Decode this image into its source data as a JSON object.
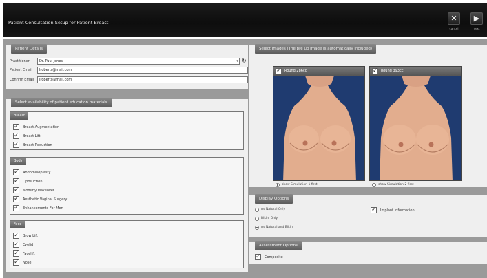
{
  "window": {
    "title": "Patient Consultation Setup for Patient Breast",
    "cancel_label": "cancel",
    "next_label": "next"
  },
  "patient_details": {
    "header": "Patient Details",
    "practitioner_label": "Practitioner",
    "practitioner_value": "Dr. Paul Jones",
    "email_label": "Patient Email",
    "email_value": "lroberts@mail.com",
    "confirm_label": "Confirm Email",
    "confirm_value": "lroberts@mail.com"
  },
  "education": {
    "header": "Select availability of patient education materials",
    "groups": [
      {
        "title": "Breast",
        "items": [
          "Breast Augmentation",
          "Breast Lift",
          "Breast Reduction"
        ]
      },
      {
        "title": "Body",
        "items": [
          "Abdominoplasty",
          "Liposuction",
          "Mommy Makeover",
          "Aesthetic Vaginal Surgery",
          "Enhancements For Men"
        ]
      },
      {
        "title": "Face",
        "items": [
          "Brow Lift",
          "Eyelid",
          "Facelift",
          "Nose"
        ]
      }
    ]
  },
  "images": {
    "header": "Select Images  (The pre up image is automatically included)",
    "cards": [
      {
        "caption": "Round 286cc",
        "radio_label": "show Simulation 1 first",
        "selected": true
      },
      {
        "caption": "Round 393cc",
        "radio_label": "show Simulation 2 first",
        "selected": false
      }
    ]
  },
  "display_options": {
    "header": "Display Options",
    "radios": [
      {
        "label": "As Natural Only",
        "selected": false
      },
      {
        "label": "Bikini Only",
        "selected": false
      },
      {
        "label": "As Natural and Bikini",
        "selected": true
      }
    ],
    "implant_info_label": "Implant Information"
  },
  "assessment": {
    "header": "Assessment Options",
    "composite_label": "Composite"
  },
  "icons": {
    "cancel": "cancel-x-icon",
    "next": "next-arrow-icon",
    "dropdown": "dropdown-arrow-icon",
    "refresh": "refresh-icon",
    "checkbox": "checkmark-icon"
  },
  "colors": {
    "top_bar": "#111111",
    "panel_header": "#6e6e6e",
    "photo_background": "#1f3b70"
  }
}
